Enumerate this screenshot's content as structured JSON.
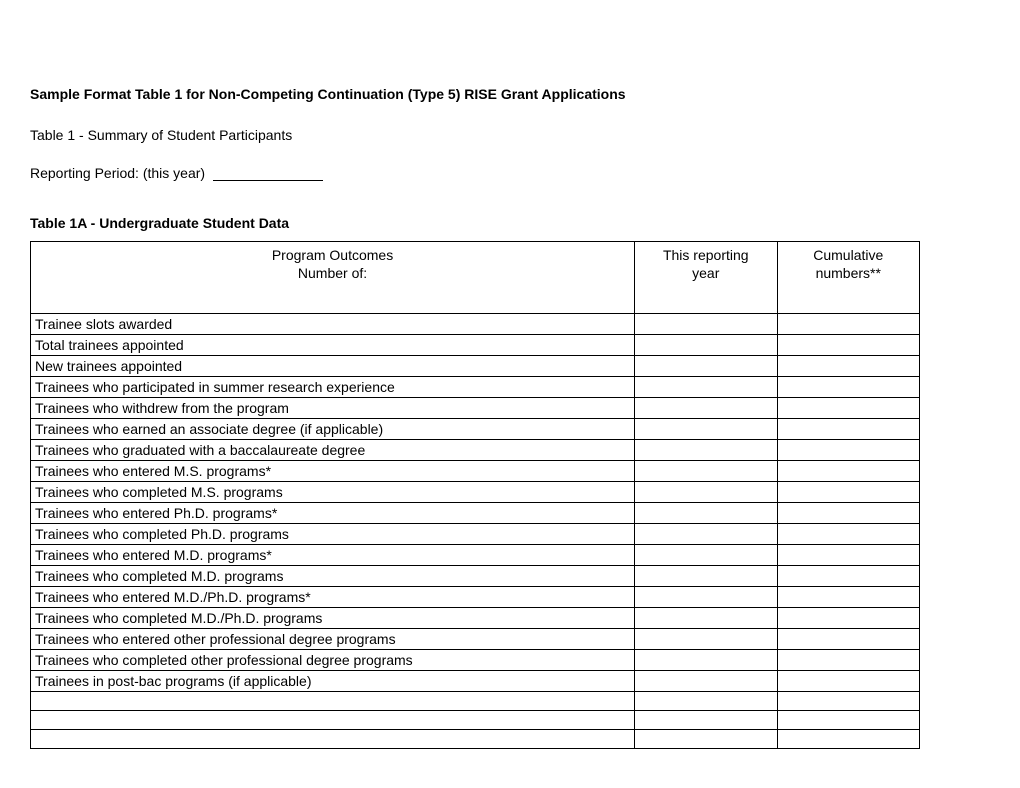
{
  "doc": {
    "title": "Sample Format Table 1 for Non-Competing Continuation (Type 5) RISE Grant Applications",
    "subtitle": "Table 1 - Summary of Student Participants",
    "reporting_prefix": "Reporting Period: (this year)",
    "table1a_heading": "Table 1A - Undergraduate Student Data"
  },
  "table": {
    "headers": {
      "outcomes_line1": "Program Outcomes",
      "outcomes_line2": "Number of:",
      "this_year_line1": "This reporting",
      "this_year_line2": "year",
      "cumulative_line1": "Cumulative",
      "cumulative_line2": "numbers**"
    },
    "rows": [
      {
        "label": "Trainee slots awarded",
        "this_year": "",
        "cumulative": ""
      },
      {
        "label": "Total trainees appointed",
        "this_year": "",
        "cumulative": ""
      },
      {
        "label": "New trainees appointed",
        "this_year": "",
        "cumulative": ""
      },
      {
        "label": "Trainees who participated in summer research experience",
        "this_year": "",
        "cumulative": ""
      },
      {
        "label": "Trainees who withdrew from the program",
        "this_year": "",
        "cumulative": ""
      },
      {
        "label": "Trainees who earned an associate degree (if applicable)",
        "this_year": "",
        "cumulative": ""
      },
      {
        "label": "Trainees who graduated with a baccalaureate degree",
        "this_year": "",
        "cumulative": ""
      },
      {
        "label": "Trainees who entered M.S. programs*",
        "this_year": "",
        "cumulative": ""
      },
      {
        "label": "Trainees who completed M.S. programs",
        "this_year": "",
        "cumulative": ""
      },
      {
        "label": "Trainees who entered Ph.D. programs*",
        "this_year": "",
        "cumulative": ""
      },
      {
        "label": "Trainees who completed Ph.D. programs",
        "this_year": "",
        "cumulative": ""
      },
      {
        "label": "Trainees who entered M.D. programs*",
        "this_year": "",
        "cumulative": ""
      },
      {
        "label": "Trainees who completed M.D. programs",
        "this_year": "",
        "cumulative": ""
      },
      {
        "label": "Trainees who entered M.D./Ph.D. programs*",
        "this_year": "",
        "cumulative": ""
      },
      {
        "label": "Trainees who completed M.D./Ph.D. programs",
        "this_year": "",
        "cumulative": ""
      },
      {
        "label": "Trainees who entered other professional degree programs",
        "this_year": "",
        "cumulative": ""
      },
      {
        "label": "Trainees who completed other professional degree programs",
        "this_year": "",
        "cumulative": ""
      },
      {
        "label": "Trainees in post-bac programs (if applicable)",
        "this_year": "",
        "cumulative": ""
      },
      {
        "label": "",
        "this_year": "",
        "cumulative": ""
      },
      {
        "label": "",
        "this_year": "",
        "cumulative": ""
      },
      {
        "label": "",
        "this_year": "",
        "cumulative": ""
      }
    ]
  }
}
